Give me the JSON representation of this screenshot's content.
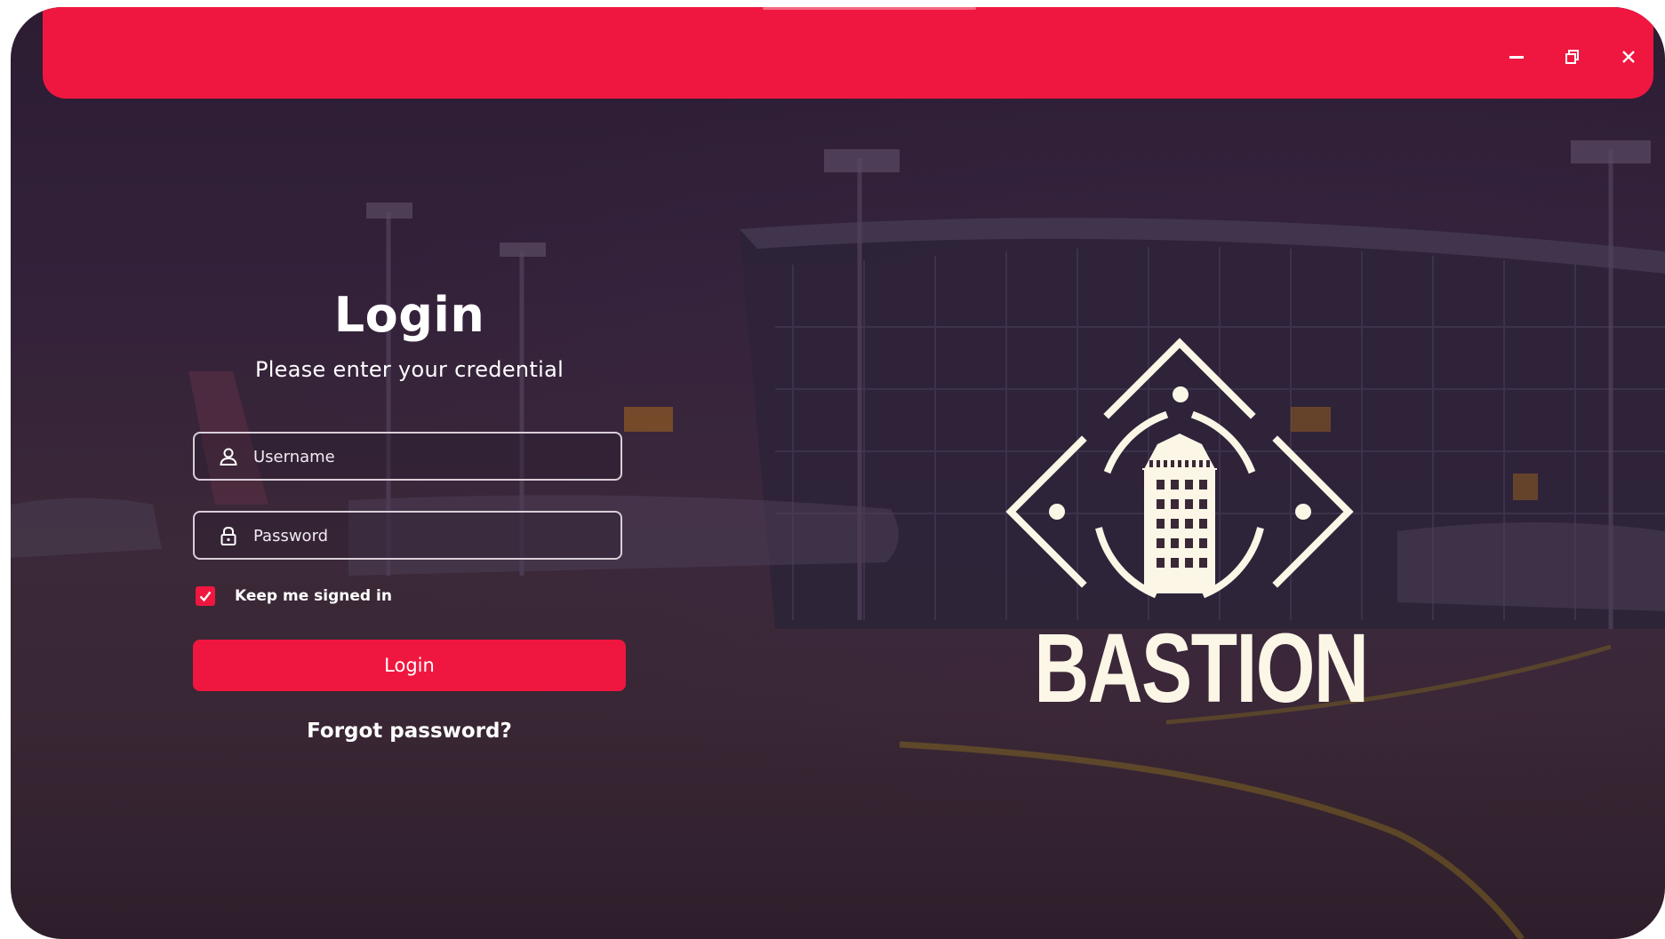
{
  "window": {
    "controls": {
      "minimize_icon": "minimize-icon",
      "restore_icon": "restore-icon",
      "close_icon": "close-icon"
    },
    "accent_color": "#ef1740"
  },
  "login": {
    "title": "Login",
    "subtitle": "Please enter your credential",
    "username": {
      "placeholder": "Username",
      "value": "",
      "icon": "user-icon"
    },
    "password": {
      "placeholder": "Password",
      "value": "",
      "icon": "lock-icon"
    },
    "keep_signed_in": {
      "label": "Keep me signed in",
      "checked": true
    },
    "submit_label": "Login",
    "forgot_label": "Forgot password?"
  },
  "brand": {
    "name": "BASTION",
    "emblem_icon": "tower-emblem-icon"
  }
}
